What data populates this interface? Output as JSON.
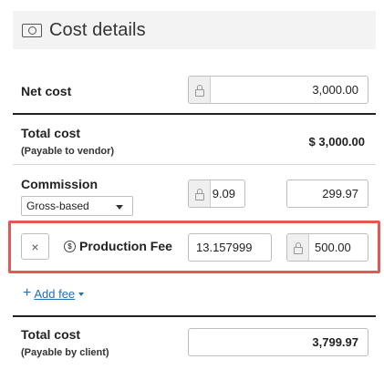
{
  "header": {
    "title": "Cost details",
    "icon": "cash-icon"
  },
  "net_cost": {
    "label": "Net cost",
    "value": "3,000.00"
  },
  "total_cost_vendor": {
    "label": "Total cost",
    "sublabel": "(Payable to vendor)",
    "value": "$ 3,000.00"
  },
  "commission": {
    "label": "Commission",
    "type_selected": "Gross-based",
    "rate": "9.09",
    "amount": "299.97"
  },
  "fee": {
    "remove_label": "×",
    "name": "Production Fee",
    "rate": "13.157999",
    "amount": "500.00"
  },
  "add_fee": {
    "label": "Add fee"
  },
  "total_cost_client": {
    "label": "Total cost",
    "sublabel": "(Payable by client)",
    "value": "3,799.97"
  },
  "colors": {
    "highlight": "#e45757",
    "link": "#1f6fb5",
    "header_bg": "#f3f3f3"
  }
}
